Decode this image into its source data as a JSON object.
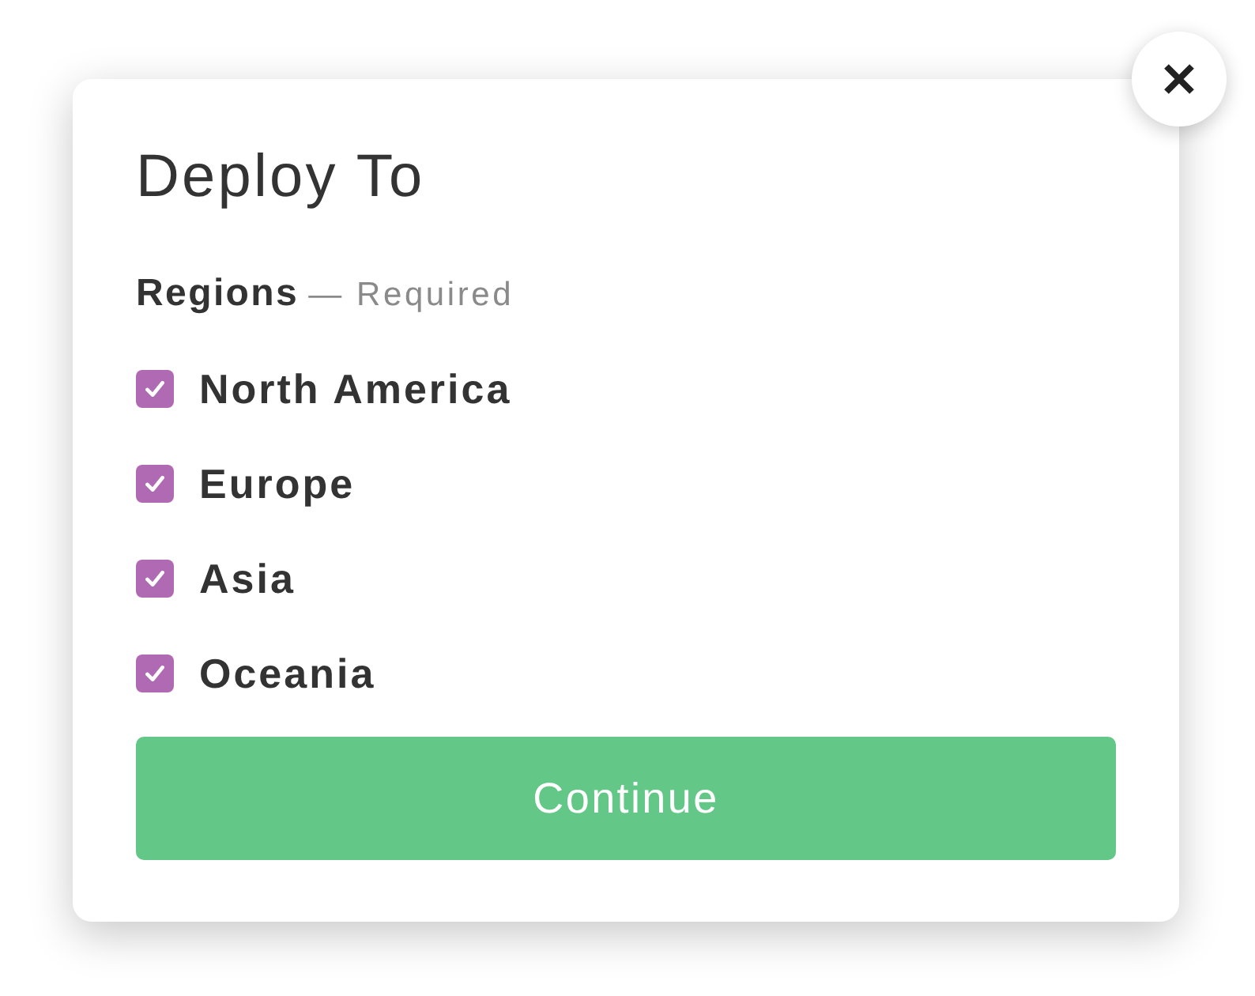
{
  "dialog": {
    "title": "Deploy To",
    "field": {
      "label": "Regions",
      "hint": "— Required"
    },
    "options": [
      {
        "label": "North America",
        "checked": true
      },
      {
        "label": "Europe",
        "checked": true
      },
      {
        "label": "Asia",
        "checked": true
      },
      {
        "label": "Oceania",
        "checked": true
      }
    ],
    "submit_button": {
      "label": "Continue"
    }
  }
}
